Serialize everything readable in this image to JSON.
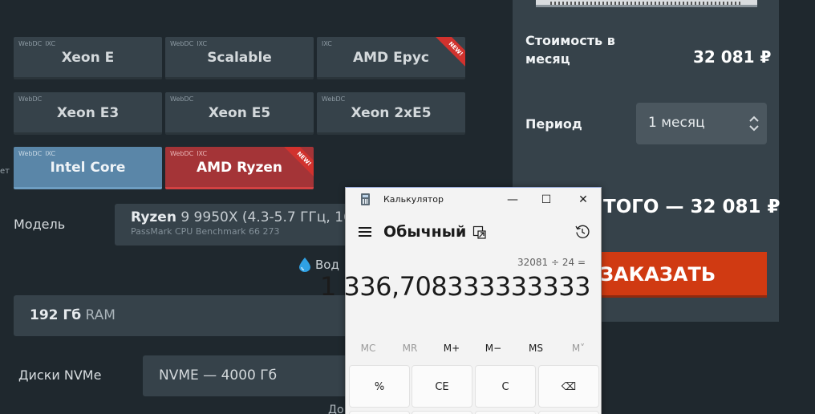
{
  "tiles": [
    {
      "tags": [
        "WebDC",
        "IXC"
      ],
      "name": "Xeon E",
      "style": "dark",
      "new": false
    },
    {
      "tags": [
        "WebDC",
        "IXC"
      ],
      "name": "Scalable",
      "style": "dark",
      "new": false
    },
    {
      "tags": [
        "IXC"
      ],
      "name": "AMD Epyc",
      "style": "dark",
      "new": true
    },
    {
      "tags": [
        "WebDC"
      ],
      "name": "Xeon E3",
      "style": "dark",
      "new": false
    },
    {
      "tags": [
        "WebDC"
      ],
      "name": "Xeon E5",
      "style": "dark",
      "new": false
    },
    {
      "tags": [
        "WebDC"
      ],
      "name": "Xeon 2xE5",
      "style": "dark",
      "new": false
    },
    {
      "tags": [
        "WebDC",
        "IXC"
      ],
      "name": "Intel Core",
      "style": "blue",
      "new": false
    },
    {
      "tags": [
        "WebDC",
        "IXC"
      ],
      "name": "AMD Ryzen",
      "style": "red",
      "new": true
    }
  ],
  "new_badge": "NEW!",
  "left_edge_fragment": "ет",
  "model": {
    "label": "Модель",
    "name_bold": "Ryzen",
    "name_rest": " 9 9950X (4.3-5.7 ГГц, 16",
    "benchmark": "PassMark CPU Benchmark 66 273"
  },
  "water_text": "Вод",
  "ram": {
    "bold": "192 Гб",
    "rest": " RAM"
  },
  "disks": {
    "label": "Диски NVMe",
    "value": "NVME — 4000 Гб"
  },
  "bottom_fragment": "До",
  "order": {
    "cost_label": "Стоимость в месяц",
    "cost_value": "32 081 ₽",
    "period_label": "Период",
    "period_value": "1 месяц",
    "total": "ТОГО — 32 081 ₽",
    "order_button": "ЗАКАЗАТЬ"
  },
  "calculator": {
    "title": "Калькулятор",
    "mode": "Обычный",
    "expression": "32081 ÷ 24 =",
    "result": "1 336,708333333333",
    "memory": [
      {
        "label": "MC",
        "enabled": false
      },
      {
        "label": "MR",
        "enabled": false
      },
      {
        "label": "M+",
        "enabled": true
      },
      {
        "label": "M−",
        "enabled": true
      },
      {
        "label": "MS",
        "enabled": true
      },
      {
        "label": "M˅",
        "enabled": false
      }
    ],
    "keys": [
      "%",
      "CE",
      "C",
      "⌫"
    ],
    "window_buttons": {
      "minimize": "—",
      "maximize": "☐",
      "close": "✕"
    }
  }
}
